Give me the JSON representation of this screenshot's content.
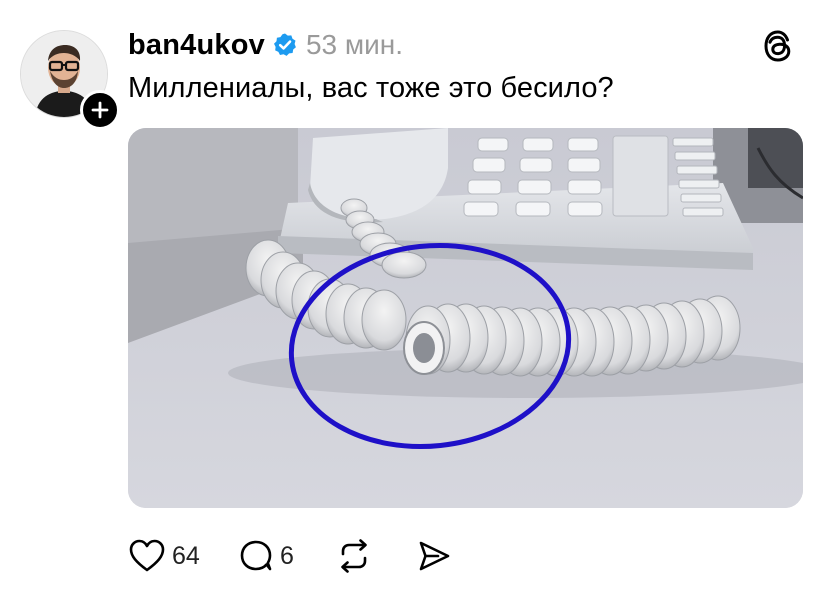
{
  "post": {
    "username": "ban4ukov",
    "time": "53 мин.",
    "caption": "Миллениалы, вас тоже это бесило?",
    "likes": "64",
    "replies": "6"
  },
  "icons": {
    "verified": "verified-badge-icon",
    "threads": "threads-logo-icon",
    "follow": "plus-icon",
    "like": "heart-icon",
    "reply": "comment-icon",
    "repost": "repost-icon",
    "share": "send-icon"
  },
  "colors": {
    "verified": "#1d9bf0",
    "annotation_circle": "#1e10c8",
    "time_text": "#9a9a9a"
  }
}
